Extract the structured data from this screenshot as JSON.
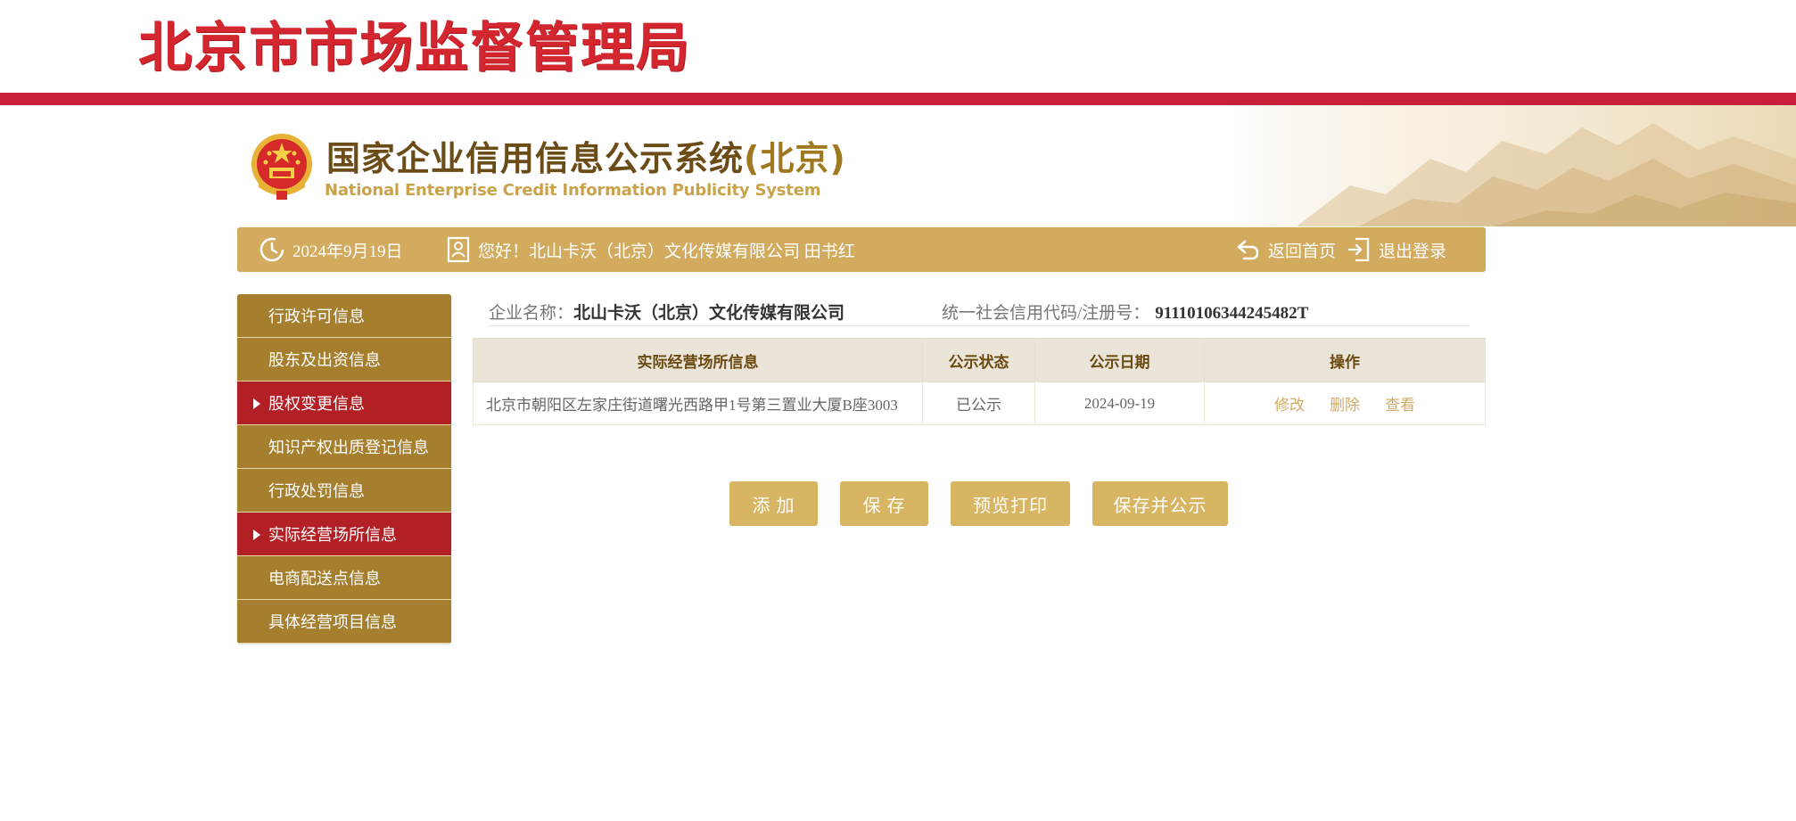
{
  "agency": {
    "title": "北京市市场监督管理局"
  },
  "system": {
    "title_cn": "国家企业信用信息公示系统",
    "title_region": "(北京)",
    "title_en": "National Enterprise Credit Information Publicity System",
    "emblem_icon": "national-emblem-icon"
  },
  "infobar": {
    "date": "2024年9月19日",
    "greeting": "您好！北山卡沃（北京）文化传媒有限公司  田书红",
    "home_label": "返回首页",
    "logout_label": "退出登录",
    "color": "#d3ab5e"
  },
  "sidebar": {
    "items": [
      {
        "label": "行政许可信息",
        "active": false
      },
      {
        "label": "股东及出资信息",
        "active": false
      },
      {
        "label": "股权变更信息",
        "active": true
      },
      {
        "label": "知识产权出质登记信息",
        "active": false
      },
      {
        "label": "行政处罚信息",
        "active": false
      },
      {
        "label": "实际经营场所信息",
        "active": true
      },
      {
        "label": "电商配送点信息",
        "active": false
      },
      {
        "label": "具体经营项目信息",
        "active": false
      }
    ],
    "color": "#a57f2e",
    "active_color": "#b21f25"
  },
  "company": {
    "name_label": "企业名称：",
    "name": "北山卡沃（北京）文化传媒有限公司",
    "code_label": "统一社会信用代码/注册号：",
    "code": "91110106344245482T"
  },
  "table": {
    "headers": [
      "实际经营场所信息",
      "公示状态",
      "公示日期",
      "操作"
    ],
    "rows": [
      {
        "address": "北京市朝阳区左家庄街道曙光西路甲1号第三置业大厦B座3003",
        "status": "已公示",
        "date": "2024-09-19",
        "actions": [
          "修改",
          "删除",
          "查看"
        ]
      }
    ]
  },
  "buttons": {
    "add": "添 加",
    "save": "保 存",
    "preview": "预览打印",
    "save_publish": "保存并公示",
    "color": "#d7b562"
  }
}
